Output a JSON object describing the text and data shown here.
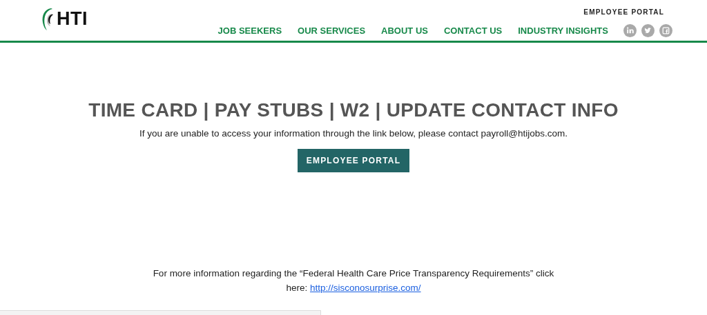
{
  "header": {
    "logo_text": "HTI",
    "top_link": "EMPLOYEE PORTAL",
    "nav": [
      {
        "label": "JOB SEEKERS"
      },
      {
        "label": "OUR SERVICES"
      },
      {
        "label": "ABOUT US"
      },
      {
        "label": "CONTACT US"
      },
      {
        "label": "INDUSTRY INSIGHTS"
      }
    ],
    "social": [
      {
        "kind": "linkedin"
      },
      {
        "kind": "twitter"
      },
      {
        "kind": "facebook"
      }
    ]
  },
  "main": {
    "title": "TIME CARD | PAY STUBS | W2 | UPDATE CONTACT INFO",
    "text": "If you are unable to access your information through the link below, please contact payroll@htijobs.com.",
    "button": "EMPLOYEE PORTAL"
  },
  "footer": {
    "text": "For more information regarding the “Federal Health Care Price Transparency Requirements” click here:",
    "link": "http://sisconosurprise.com/"
  }
}
